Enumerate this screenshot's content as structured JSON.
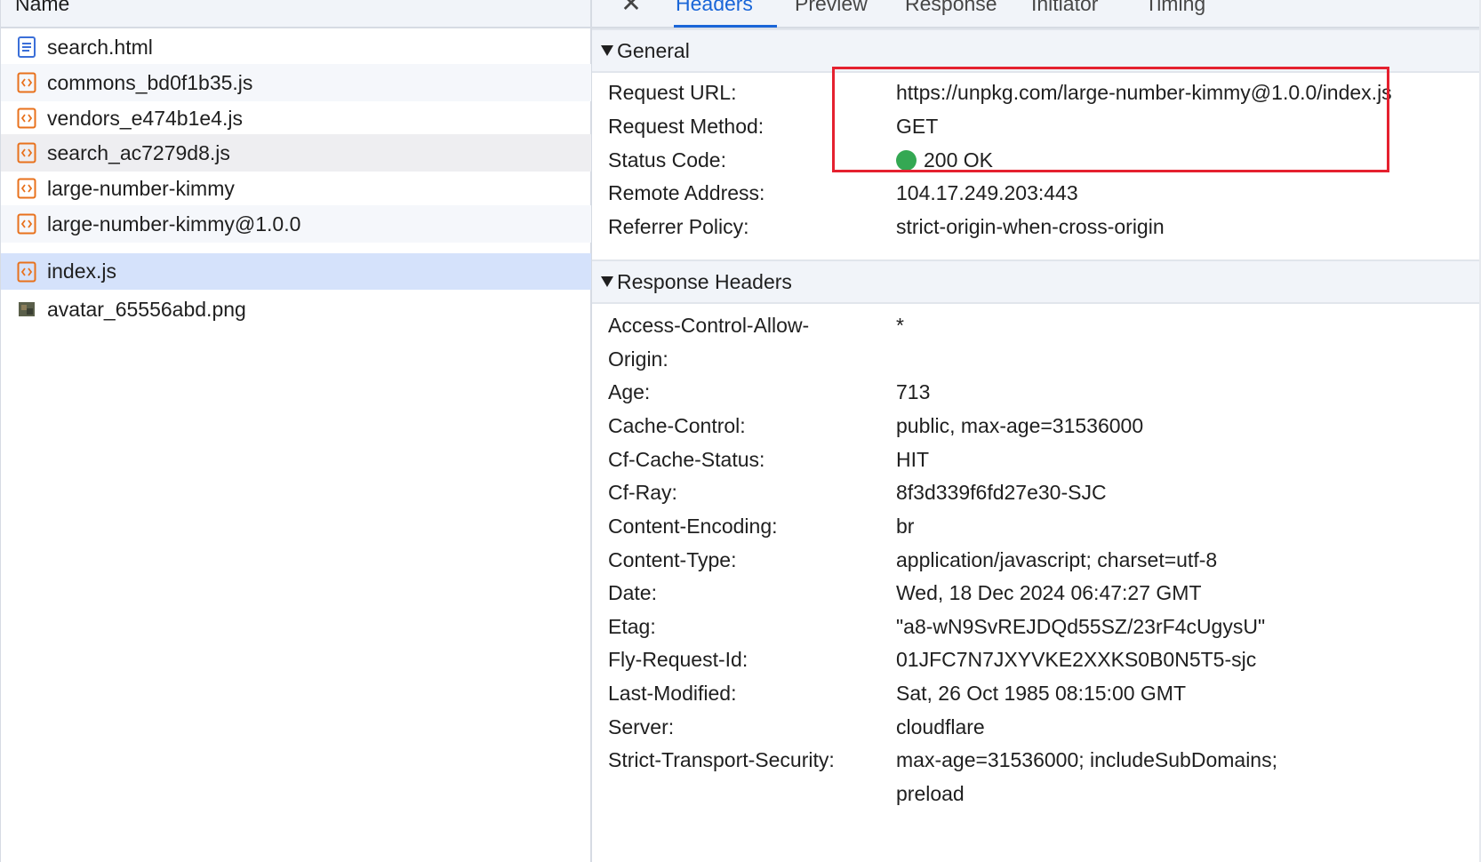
{
  "file_list": {
    "header": "Name",
    "items": [
      {
        "name": "search.html",
        "icon": "document-icon",
        "type": "html"
      },
      {
        "name": "commons_bd0f1b35.js",
        "icon": "script-icon",
        "type": "js"
      },
      {
        "name": "vendors_e474b1e4.js",
        "icon": "script-icon",
        "type": "js"
      },
      {
        "name": "search_ac7279d8.js",
        "icon": "script-icon",
        "type": "js"
      },
      {
        "name": "large-number-kimmy",
        "icon": "script-icon",
        "type": "js"
      },
      {
        "name": "large-number-kimmy@1.0.0",
        "icon": "script-icon",
        "type": "js"
      },
      {
        "name": "index.js",
        "icon": "script-icon",
        "type": "js",
        "selected": true
      },
      {
        "name": "avatar_65556abd.png",
        "icon": "image-icon",
        "type": "png"
      }
    ]
  },
  "tabs": {
    "close_glyph": "✕",
    "items": [
      "Headers",
      "Preview",
      "Response",
      "Initiator",
      "Timing"
    ],
    "active": "Headers"
  },
  "general": {
    "title": "General",
    "rows": [
      {
        "key": "Request URL:",
        "value": "https://unpkg.com/large-number-kimmy@1.0.0/index.js"
      },
      {
        "key": "Request Method:",
        "value": "GET"
      },
      {
        "key": "Status Code:",
        "value": "200 OK"
      },
      {
        "key": "Remote Address:",
        "value": "104.17.249.203:443"
      },
      {
        "key": "Referrer Policy:",
        "value": "strict-origin-when-cross-origin"
      }
    ]
  },
  "response_headers": {
    "title": "Response Headers",
    "rows": [
      {
        "key": "Access-Control-Allow-",
        "key2": "Origin:",
        "value": "*"
      },
      {
        "key": "Age:",
        "value": "713"
      },
      {
        "key": "Cache-Control:",
        "value": "public, max-age=31536000"
      },
      {
        "key": "Cf-Cache-Status:",
        "value": "HIT"
      },
      {
        "key": "Cf-Ray:",
        "value": "8f3d339f6fd27e30-SJC"
      },
      {
        "key": "Content-Encoding:",
        "value": "br"
      },
      {
        "key": "Content-Type:",
        "value": "application/javascript; charset=utf-8"
      },
      {
        "key": "Date:",
        "value": "Wed, 18 Dec 2024 06:47:27 GMT"
      },
      {
        "key": "Etag:",
        "value": "\"a8-wN9SvREJDQd55SZ/23rF4cUgysU\""
      },
      {
        "key": "Fly-Request-Id:",
        "value": "01JFC7N7JXYVKE2XXKS0B0N5T5-sjc"
      },
      {
        "key": "Last-Modified:",
        "value": "Sat, 26 Oct 1985 08:15:00 GMT"
      },
      {
        "key": "Server:",
        "value": "cloudflare"
      },
      {
        "key": "Strict-Transport-Security:",
        "value": "max-age=31536000; includeSubDomains;",
        "value2": "preload"
      }
    ]
  },
  "colors": {
    "accent": "#1a66d8",
    "selected_row": "#d5e2fb",
    "status_ok": "#34a853",
    "highlight_box": "#e5212f",
    "script_icon": "#e8711c",
    "document_icon": "#3b6fd8"
  }
}
